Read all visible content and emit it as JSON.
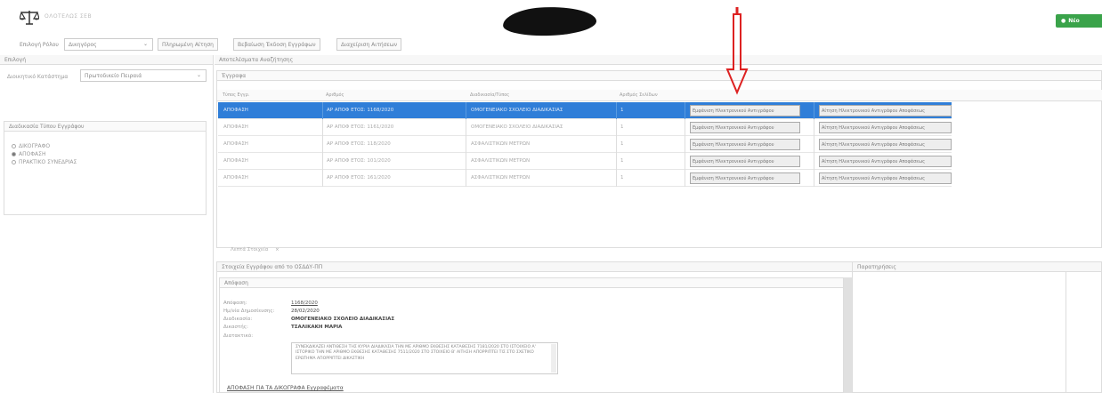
{
  "header": {
    "app_title": "ΟΛΟΤΕΛΩΣ ΣΕΒ",
    "new_button": "Νέο",
    "redacted": "█"
  },
  "toolbar": {
    "label": "Επιλογή Ρόλου",
    "role_select": "Δικηγόρος",
    "buttons": [
      "Πληρωμένη Αίτηση",
      "Βεβαίωση Έκδοση Εγγράφων",
      "Διαχείριση Αιτήσεων"
    ]
  },
  "left": {
    "header": "Επιλογή",
    "field_label": "Διοικητικό Κατάστημα",
    "field_value": "Πρωτοδικείο Πειραιά",
    "filter_header": "Διαδικασία Τύπου Εγγράφου",
    "options": [
      {
        "label": "ΔΙΚΟΓΡΑΦΟ",
        "selected": false
      },
      {
        "label": "ΑΠΟΦΑΣΗ",
        "selected": true
      },
      {
        "label": "ΠΡΑΚΤΙΚΟ ΣΥΝΕΔΡΙΑΣ",
        "selected": false
      }
    ]
  },
  "results": {
    "section_title": "Αποτελέσματα Αναζήτησης",
    "sub_header": "Έγγραφα",
    "columns": [
      "Τύπος Εγγρ.",
      "Αριθμός",
      "Διαδικασία/Τύπος",
      "Αριθμός Σελίδων",
      "",
      ""
    ],
    "rows": [
      {
        "type": "ΑΠΟΦΑΣΗ",
        "number": "ΑΡ ΑΠΟΦ ΕΤΟΣ: 1168/2020",
        "procedure": "ΟΜΟΓΕΝΕΙΑΚΟ ΣΧΟΛΕΙΟ ΔΙΑΔΙΚΑΣΙΑΣ",
        "pages": "1",
        "action1": "Εμφάνιση Ηλεκτρονικού Αντιγράφου",
        "action2": "Αίτηση Ηλεκτρονικού Αντιγράφου Αποφάσεως"
      },
      {
        "type": "ΑΠΟΦΑΣΗ",
        "number": "ΑΡ ΑΠΟΦ ΕΤΟΣ: 1161/2020",
        "procedure": "ΟΜΟΓΕΝΕΙΑΚΟ ΣΧΟΛΕΙΟ ΔΙΑΔΙΚΑΣΙΑΣ",
        "pages": "1",
        "action1": "Εμφάνιση Ηλεκτρονικού Αντιγράφου",
        "action2": "Αίτηση Ηλεκτρονικού Αντιγράφου Αποφάσεως"
      },
      {
        "type": "ΑΠΟΦΑΣΗ",
        "number": "ΑΡ ΑΠΟΦ ΕΤΟΣ: 118/2020",
        "procedure": "ΑΣΦΑΛΙΣΤΙΚΩΝ ΜΕΤΡΩΝ",
        "pages": "1",
        "action1": "Εμφάνιση Ηλεκτρονικού Αντιγράφου",
        "action2": "Αίτηση Ηλεκτρονικού Αντιγράφου Αποφάσεως"
      },
      {
        "type": "ΑΠΟΦΑΣΗ",
        "number": "ΑΡ ΑΠΟΦ ΕΤΟΣ: 101/2020",
        "procedure": "ΑΣΦΑΛΙΣΤΙΚΩΝ ΜΕΤΡΩΝ",
        "pages": "1",
        "action1": "Εμφάνιση Ηλεκτρονικού Αντιγράφου",
        "action2": "Αίτηση Ηλεκτρονικού Αντιγράφου Αποφάσεως"
      },
      {
        "type": "ΑΠΟΦΑΣΗ",
        "number": "ΑΡ ΑΠΟΦ ΕΤΟΣ: 161/2020",
        "procedure": "ΑΣΦΑΛΙΣΤΙΚΩΝ ΜΕΤΡΩΝ",
        "pages": "1",
        "action1": "Εμφάνιση Ηλεκτρονικού Αντιγράφου",
        "action2": "Αίτηση Ηλεκτρονικού Αντιγράφου Αποφάσεως"
      }
    ]
  },
  "tabs": {
    "label": "Λεπτά Στοιχεία",
    "close": "×"
  },
  "detail": {
    "header": "Στοιχεία Εγγράφου από το ΟΣΔΔΥ-ΠΠ",
    "sub_header": "Απόφαση",
    "fields": [
      {
        "label": "Απόφαση:",
        "value": "1168/2020",
        "link": true
      },
      {
        "label": "Ημ/νία Δημοσίευσης:",
        "value": "28/02/2020",
        "link": false
      },
      {
        "label": "Διαδικασία:",
        "value": "ΟΜΟΓΕΝΕΙΑΚΟ ΣΧΟΛΕΙΟ ΔΙΑΔΙΚΑΣΙΑΣ",
        "link": false
      },
      {
        "label": "Δικαστής:",
        "value": "ΤΣΑΛΙΚΑΚΗ ΜΑΡΙΑ",
        "link": false
      },
      {
        "label": "Διατακτικό:",
        "value": "",
        "link": false
      }
    ],
    "text": "ΣΥΝΕΚΔΙΚΑΖΕΙ ΑΝΤΙΘΕΣΗ ΤΗΣ ΚΥΡΙΑ ΔΙΑΔΙΚΑΣΙΑ ΤΗΝ ΜΕ ΑΡΙΘΜΟ ΕΚΘΕΣΗΣ ΚΑΤΑΘΕΣΗΣ 7181/2020 ΣΤΟ ΙΣΤΟΙΧΕΙΟ Α' ΙΣΤΟΡΙΚΟ ΤΗΝ ΜΕ ΑΡΙΘΜΟ ΕΚΘΕΣΗΣ ΚΑΤΑΘΕΣΗΣ 7511/2020 ΣΤΟ ΣΤΟΙΧΕΙΟ Β' ΑΙΤΗΣΗ ΑΠΟΡΡΙΠΤΕΙ ΤΙΣ ΣΤΟ ΣΧΕΤΙΚΟ ΕΡΩΤΗΜΑ ΑΠΟΡΡΙΠΤΕΙ ΔΙΚΑΣΤΙΚΗ",
    "bottom_link": "ΑΠΟΦΑΣΗ ΓΙΑ ΤΑ ΔΙΚΟΓΡΑΦΑ Εγγραφέματα"
  },
  "notes": {
    "header": "Παρατηρήσεις"
  }
}
